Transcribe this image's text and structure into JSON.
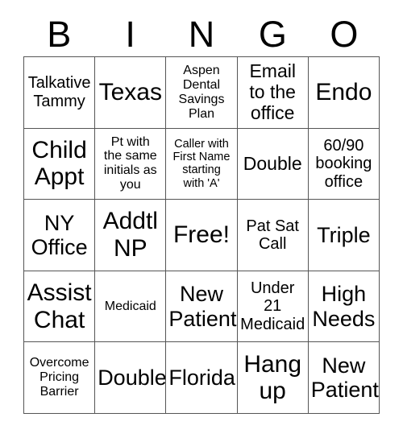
{
  "card": {
    "header_letters": [
      "B",
      "I",
      "N",
      "G",
      "O"
    ],
    "grid": {
      "columns": 5,
      "rows": 5,
      "border_color": "#555555",
      "background_color": "#ffffff",
      "text_color": "#000000"
    },
    "cells": [
      {
        "text": "Talkative\nTammy",
        "size": "md",
        "free": false
      },
      {
        "text": "Texas",
        "size": "xxl",
        "free": false
      },
      {
        "text": "Aspen\nDental\nSavings\nPlan",
        "size": "sm",
        "free": false
      },
      {
        "text": "Email\nto the\noffice",
        "size": "lg",
        "free": false
      },
      {
        "text": "Endo",
        "size": "xxl",
        "free": false
      },
      {
        "text": "Child\nAppt",
        "size": "xxl",
        "free": false
      },
      {
        "text": "Pt with\nthe same\ninitials as\nyou",
        "size": "sm",
        "free": false
      },
      {
        "text": "Caller with\nFirst Name\nstarting\nwith 'A'",
        "size": "xs",
        "free": false
      },
      {
        "text": "Double",
        "size": "lg",
        "free": false
      },
      {
        "text": "60/90\nbooking\noffice",
        "size": "md",
        "free": false
      },
      {
        "text": "NY\nOffice",
        "size": "xl",
        "free": false
      },
      {
        "text": "Addtl\nNP",
        "size": "xxl",
        "free": false
      },
      {
        "text": "Free!",
        "size": "xxl",
        "free": true
      },
      {
        "text": "Pat Sat\nCall",
        "size": "md",
        "free": false
      },
      {
        "text": "Triple",
        "size": "xl",
        "free": false
      },
      {
        "text": "Assist\nChat",
        "size": "xxl",
        "free": false
      },
      {
        "text": "Medicaid",
        "size": "sm",
        "free": false
      },
      {
        "text": "New\nPatient",
        "size": "xl",
        "free": false
      },
      {
        "text": "Under\n21\nMedicaid",
        "size": "md",
        "free": false
      },
      {
        "text": "High\nNeeds",
        "size": "xl",
        "free": false
      },
      {
        "text": "Overcome\nPricing\nBarrier",
        "size": "sm",
        "free": false
      },
      {
        "text": "Double",
        "size": "xl",
        "free": false
      },
      {
        "text": "Florida",
        "size": "xl",
        "free": false
      },
      {
        "text": "Hang\nup",
        "size": "xxl",
        "free": false
      },
      {
        "text": "New\nPatient",
        "size": "xl",
        "free": false
      }
    ]
  }
}
